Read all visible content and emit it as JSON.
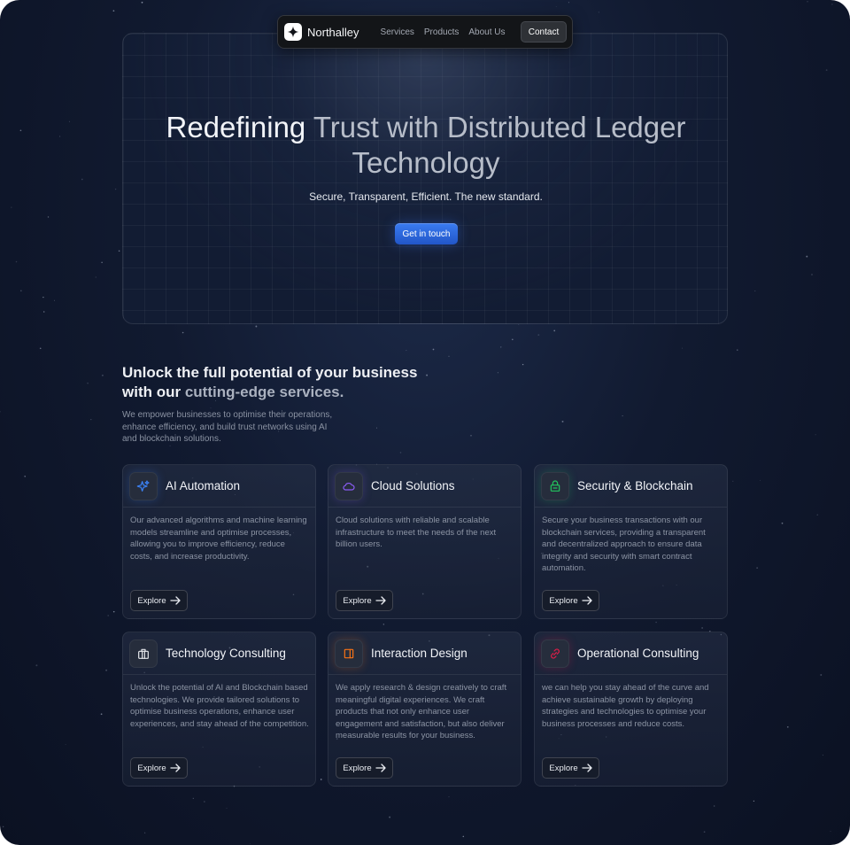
{
  "nav": {
    "brand": "Northalley",
    "links": [
      "Services",
      "Products",
      "About Us"
    ],
    "contact_label": "Contact"
  },
  "hero": {
    "title_bright": "Redefining",
    "title_dim": "Trust with Distributed Ledger Technology",
    "subtitle": "Secure, Transparent, Efficient. The new standard.",
    "cta_label": "Get in touch"
  },
  "services": {
    "heading_bright": "Unlock the full potential of your business with our",
    "heading_dim": "cutting-edge services.",
    "description": "We empower businesses to optimise their operations, enhance efficiency, and build trust networks using AI and blockchain solutions.",
    "cards": [
      {
        "title": "AI Automation",
        "icon": "sparkles-icon",
        "icon_color": "#3b82f6",
        "text": "Our advanced algorithms and machine learning models streamline and optimise processes, allowing you to improve efficiency, reduce costs, and increase productivity.",
        "explore": "Explore"
      },
      {
        "title": "Cloud Solutions",
        "icon": "cloud-icon",
        "icon_color": "#8b5cf6",
        "text": "Cloud solutions with reliable and scalable infrastructure to meet the needs of the next billion users.",
        "explore": "Explore"
      },
      {
        "title": "Security & Blockchain",
        "icon": "lock-icon",
        "icon_color": "#22c55e",
        "text": "Secure your business transactions with our blockchain services, providing a transparent and decentralized approach to ensure data integrity and security with smart contract automation.",
        "explore": "Explore"
      },
      {
        "title": "Technology Consulting",
        "icon": "briefcase-icon",
        "icon_color": "#e5e7eb",
        "text": "Unlock the potential of AI and Blockchain based technologies. We provide tailored solutions to optimise business operations, enhance user experiences, and stay ahead of the competition.",
        "explore": "Explore"
      },
      {
        "title": "Interaction Design",
        "icon": "layout-icon",
        "icon_color": "#f97316",
        "text": "We apply research & design creatively to craft meaningful digital experiences. We craft products that not only enhance user engagement and satisfaction, but also deliver measurable results for your business.",
        "explore": "Explore"
      },
      {
        "title": "Operational Consulting",
        "icon": "link-icon",
        "icon_color": "#e11d48",
        "text": "we can help you stay ahead of the curve and achieve sustainable growth by deploying strategies and technologies to optimise your business processes and reduce costs.",
        "explore": "Explore"
      }
    ]
  }
}
